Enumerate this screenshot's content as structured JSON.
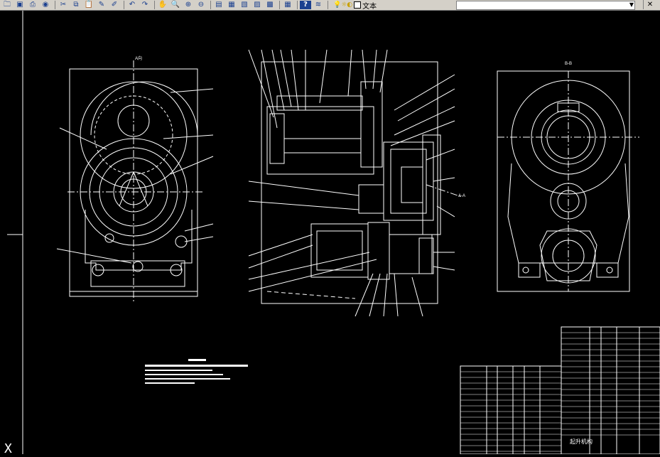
{
  "toolbar": {
    "buttons": [
      {
        "name": "open-icon",
        "glyph": "🗀"
      },
      {
        "name": "save-icon",
        "glyph": "▣"
      },
      {
        "name": "plot-icon",
        "glyph": "⎙"
      },
      {
        "name": "publish-icon",
        "glyph": "◉"
      },
      {
        "name": "cut-icon",
        "glyph": "✂"
      },
      {
        "name": "copy-icon",
        "glyph": "⧉"
      },
      {
        "name": "paste-icon",
        "glyph": "📋"
      },
      {
        "name": "match-properties-icon",
        "glyph": "✎"
      },
      {
        "name": "block-editor-icon",
        "glyph": "✐"
      },
      {
        "name": "undo-icon",
        "glyph": "↶"
      },
      {
        "name": "redo-icon",
        "glyph": "↷"
      },
      {
        "name": "pan-icon",
        "glyph": "✋"
      },
      {
        "name": "zoom-realtime-icon",
        "glyph": "🔍"
      },
      {
        "name": "zoom-window-icon",
        "glyph": "⊕"
      },
      {
        "name": "zoom-previous-icon",
        "glyph": "⊖"
      },
      {
        "name": "properties-icon",
        "glyph": "▤"
      },
      {
        "name": "design-center-icon",
        "glyph": "▦"
      },
      {
        "name": "tool-palettes-icon",
        "glyph": "▧"
      },
      {
        "name": "sheet-set-icon",
        "glyph": "▨"
      },
      {
        "name": "markup-icon",
        "glyph": "▩"
      },
      {
        "name": "calculator-icon",
        "glyph": "▦"
      },
      {
        "name": "help-icon",
        "glyph": "?"
      },
      {
        "name": "layer-manager-icon",
        "glyph": "≋"
      }
    ],
    "layer_name": "文本",
    "close_glyph": "✕"
  },
  "drawing": {
    "title_block_name": "起升机构",
    "ucs_glyph": "X",
    "section_label_a": "A-A"
  },
  "colors": {
    "background": "#000000",
    "lines": "#ffffff",
    "toolbar": "#d4d0c8"
  }
}
